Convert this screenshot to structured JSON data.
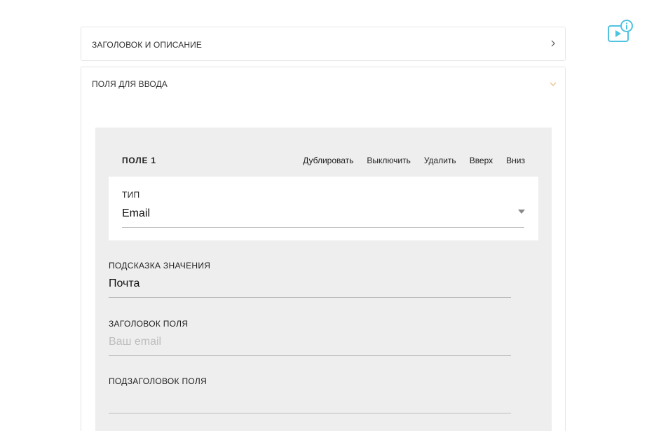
{
  "sections": [
    {
      "title": "ЗАГОЛОВОК И ОПИСАНИЕ",
      "state": "collapsed"
    },
    {
      "title": "ПОЛЯ ДЛЯ ВВОДА",
      "state": "expanded"
    }
  ],
  "field": {
    "title": "ПОЛЕ 1",
    "actions": [
      "Дублировать",
      "Выключить",
      "Удалить",
      "Вверх",
      "Вниз"
    ],
    "type": {
      "label": "ТИП",
      "value": "Email"
    },
    "hint": {
      "label": "ПОДСКАЗКА ЗНАЧЕНИЯ",
      "value": "Почта"
    },
    "field_title": {
      "label": "ЗАГОЛОВОК ПОЛЯ",
      "placeholder": "Ваш email"
    },
    "field_subtitle": {
      "label": "ПОДЗАГОЛОВОК ПОЛЯ",
      "value": ""
    }
  },
  "colors": {
    "accent": "#4fc3e0",
    "chevron_open": "#e8b57a"
  },
  "icons": {
    "help": "video-info-icon"
  }
}
